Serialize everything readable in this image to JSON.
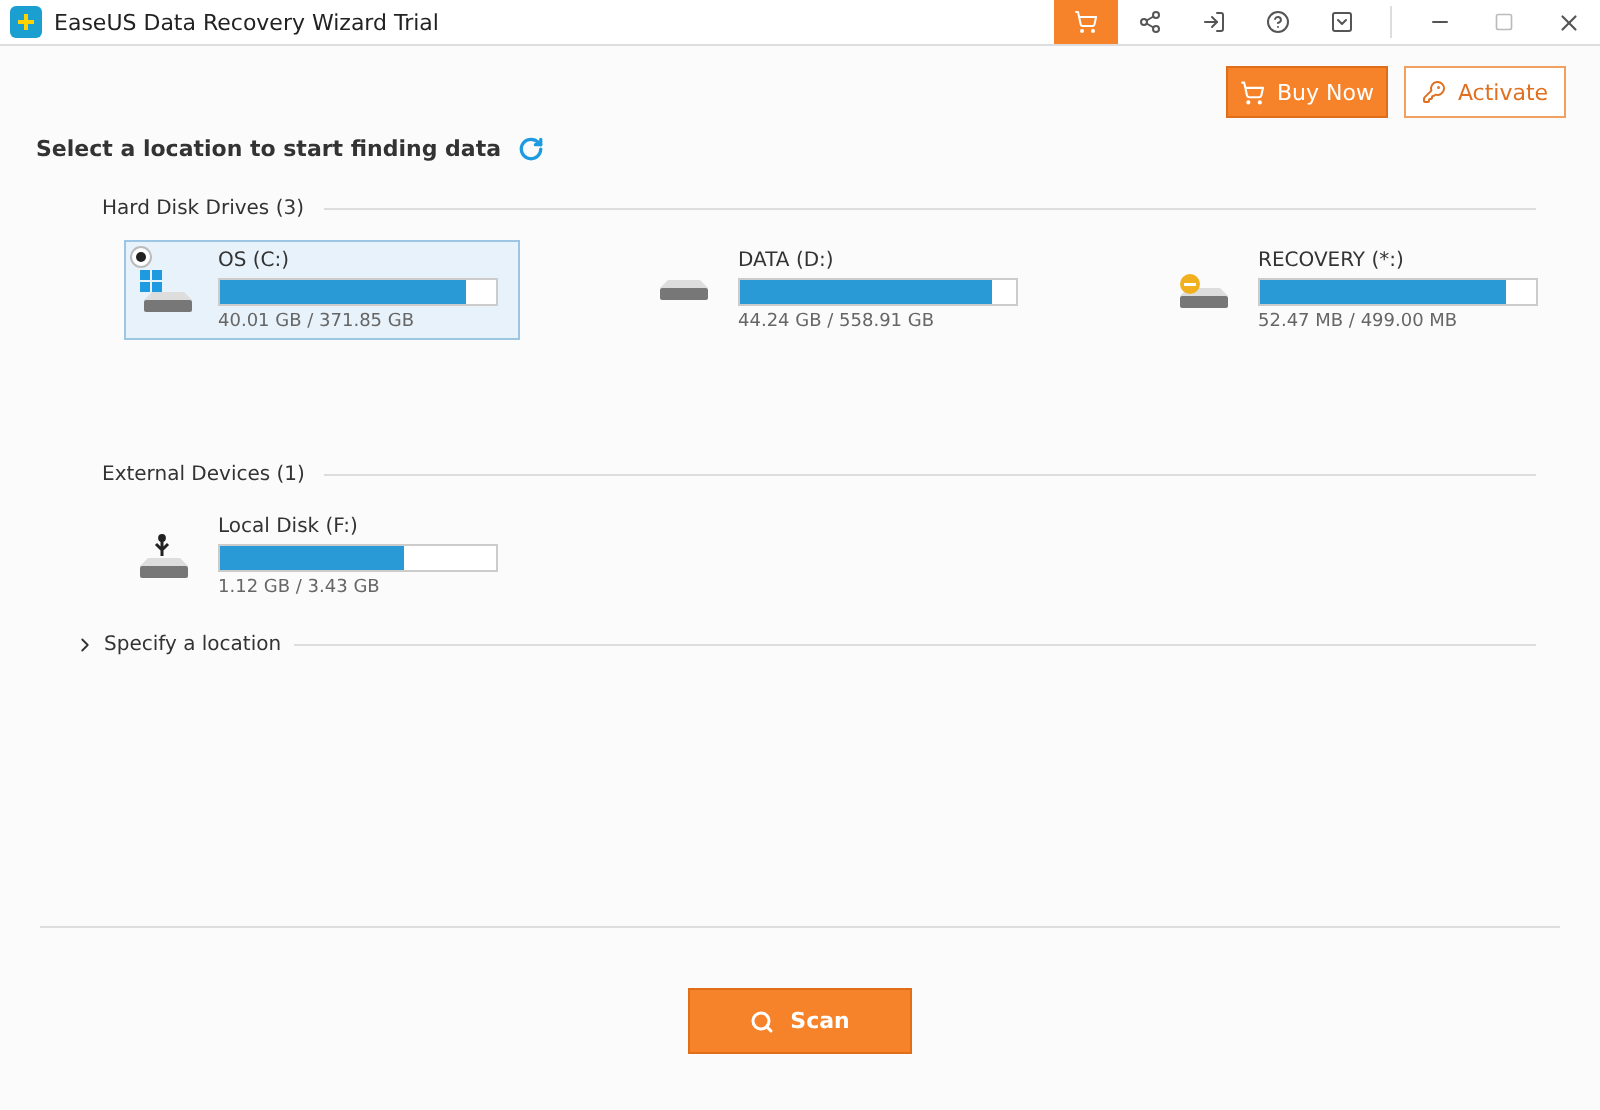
{
  "window": {
    "title": "EaseUS Data Recovery Wizard Trial"
  },
  "toolbar": {
    "buy_now": "Buy Now",
    "activate": "Activate"
  },
  "heading": "Select a location to start finding data",
  "sections": [
    {
      "title": "Hard Disk Drives (3)",
      "drives": [
        {
          "name": "OS (C:)",
          "kind": "windows",
          "level": 0.89,
          "usage": "40.01 GB / 371.85 GB",
          "selected": true
        },
        {
          "name": "DATA (D:)",
          "kind": "plain",
          "level": 0.91,
          "usage": "44.24 GB / 558.91 GB",
          "selected": false
        },
        {
          "name": "RECOVERY (*:)",
          "kind": "recovery",
          "level": 0.89,
          "usage": "52.47 MB / 499.00 MB",
          "selected": false
        }
      ]
    },
    {
      "title": "External Devices (1)",
      "drives": [
        {
          "name": "Local Disk (F:)",
          "kind": "usb",
          "level": 0.67,
          "usage": "1.12 GB / 3.43 GB",
          "selected": false
        }
      ]
    }
  ],
  "specify": {
    "label": "Specify a location",
    "expanded": false
  },
  "scan": "Scan"
}
